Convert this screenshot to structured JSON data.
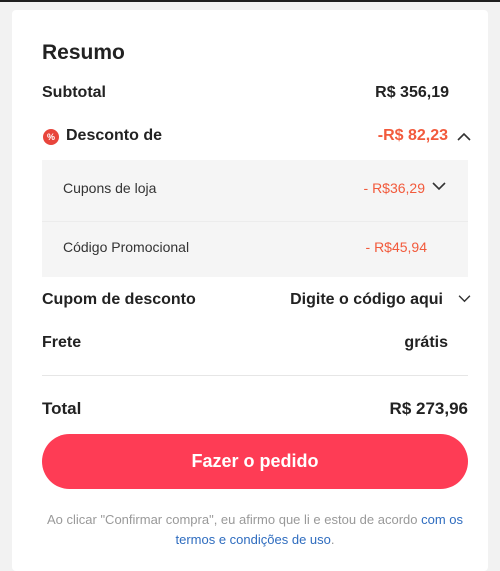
{
  "summary": {
    "title": "Resumo",
    "subtotal": {
      "label": "Subtotal",
      "value": "R$ 356,19"
    },
    "discount": {
      "icon": "percent-badge-icon",
      "label": "Desconto de",
      "value": "-R$ 82,23",
      "expanded": true,
      "items": [
        {
          "label": "Cupons de loja",
          "value": "- R$36,29",
          "has_dropdown": true
        },
        {
          "label": "Código Promocional",
          "value": "- R$45,94",
          "has_dropdown": false
        }
      ]
    },
    "coupon": {
      "label": "Cupom de desconto",
      "placeholder": "Digite o código aqui"
    },
    "shipping": {
      "label": "Frete",
      "value": "grátis"
    },
    "total": {
      "label": "Total",
      "value": "R$ 273,96"
    }
  },
  "order_button": {
    "label": "Fazer o pedido"
  },
  "legal": {
    "text": "Ao clicar \"Confirmar compra\", eu afirmo que li e estou de acordo ",
    "link": "com os termos e condições de uso",
    "suffix": "."
  },
  "colors": {
    "accent": "#fe3c55",
    "discount": "#f25a3c",
    "link": "#2e6cbf"
  }
}
